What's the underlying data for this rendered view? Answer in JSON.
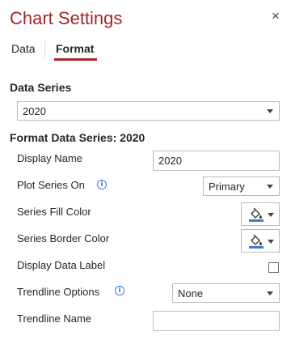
{
  "header": {
    "title": "Chart Settings",
    "close_symbol": "×"
  },
  "tabs": [
    {
      "label": "Data",
      "active": false
    },
    {
      "label": "Format",
      "active": true
    }
  ],
  "data_series": {
    "heading": "Data Series",
    "selected": "2020"
  },
  "format_section": {
    "heading": "Format Data Series: 2020",
    "display_name": {
      "label": "Display Name",
      "value": "2020"
    },
    "plot_series_on": {
      "label": "Plot Series On",
      "selected": "Primary",
      "info_icon": "info-icon"
    },
    "fill_color": {
      "label": "Series Fill Color",
      "color": "#3b7fd0",
      "icon": "paint-bucket-icon"
    },
    "border_color": {
      "label": "Series Border Color",
      "color": "#3b7fd0",
      "icon": "paint-bucket-icon"
    },
    "data_label": {
      "label": "Display Data Label",
      "checked": false
    },
    "trendline_options": {
      "label": "Trendline Options",
      "selected": "None",
      "info_icon": "info-icon"
    },
    "trendline_name": {
      "label": "Trendline Name",
      "value": ""
    }
  },
  "colors": {
    "accent": "#a4262c",
    "info": "#3b7fd0",
    "border": "#bcbcbc"
  }
}
